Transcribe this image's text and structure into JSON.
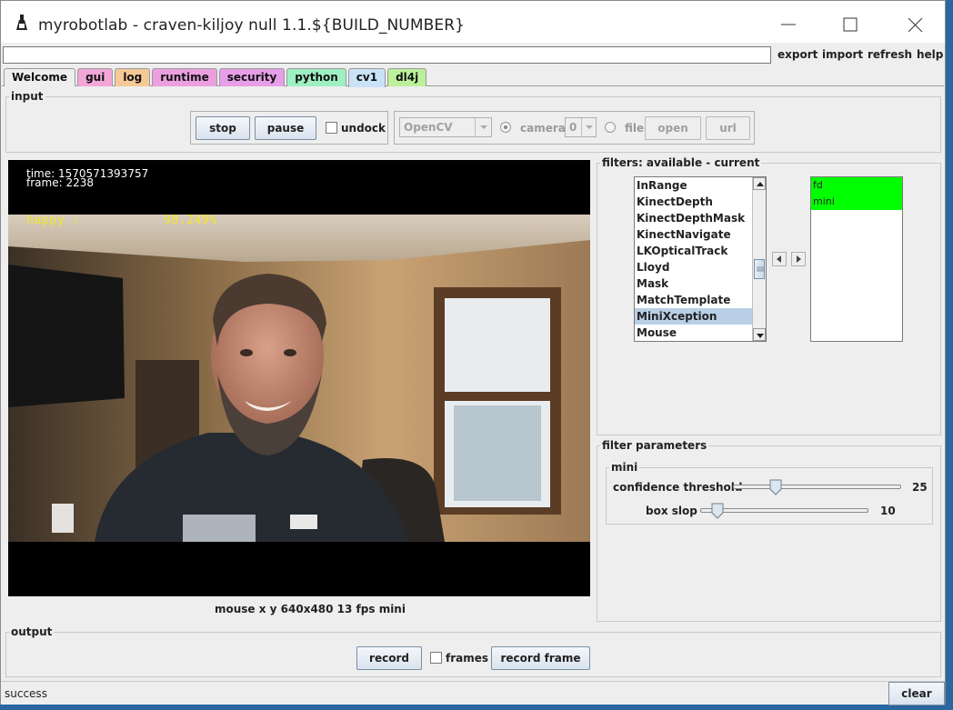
{
  "window": {
    "title": "myrobotlab - craven-kiljoy null 1.1.${BUILD_NUMBER}"
  },
  "menu": {
    "address_value": "",
    "export": "export",
    "import": "import",
    "refresh": "refresh",
    "help": "help"
  },
  "tabs": [
    {
      "label": "Welcome",
      "color": "#eeeeee"
    },
    {
      "label": "gui",
      "color": "#f2a6d8"
    },
    {
      "label": "log",
      "color": "#f5c996"
    },
    {
      "label": "runtime",
      "color": "#ec9fe0"
    },
    {
      "label": "security",
      "color": "#e79ee8"
    },
    {
      "label": "python",
      "color": "#9ef0c2"
    },
    {
      "label": "cv1",
      "color": "#c9e2f7"
    },
    {
      "label": "dl4j",
      "color": "#bdf09a"
    }
  ],
  "input": {
    "title": "input",
    "stop": "stop",
    "pause": "pause",
    "undock": "undock",
    "grabber": "OpenCV",
    "camera": "camera",
    "camera_index": "0",
    "file": "file",
    "open": "open",
    "url": "url"
  },
  "video": {
    "time": "time: 1570571393757",
    "frame": "frame: 2238",
    "emotion_label": "happy :",
    "emotion_value": "98.249%",
    "status": "mouse x y  640x480  13 fps  mini"
  },
  "filters": {
    "title": "filters: available - current",
    "available": [
      "InRange",
      "KinectDepth",
      "KinectDepthMask",
      "KinectNavigate",
      "LKOpticalTrack",
      "Lloyd",
      "Mask",
      "MatchTemplate",
      "MiniXception",
      "Mouse"
    ],
    "selected_available": "MiniXception",
    "current": [
      "fd",
      "mini"
    ],
    "current_color": "#00ff00"
  },
  "filter_parameters": {
    "title": "filter parameters",
    "group": "mini",
    "confidence_label": "confidence threshold",
    "confidence_value": "25",
    "box_slop_label": "box slop",
    "box_slop_value": "10"
  },
  "output": {
    "title": "output",
    "record": "record",
    "frames": "frames",
    "record_frame": "record frame"
  },
  "status": {
    "text": "success",
    "clear": "clear"
  }
}
